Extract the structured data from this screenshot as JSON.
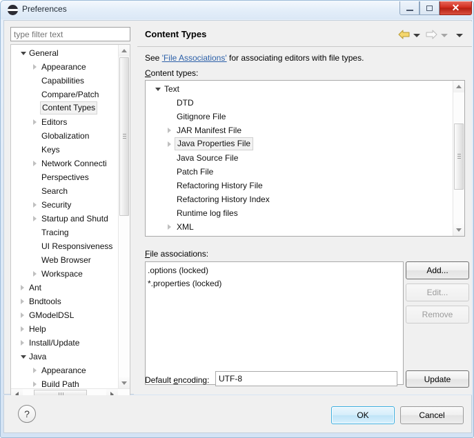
{
  "window": {
    "title": "Preferences",
    "icon": "preferences-icon",
    "controls": {
      "minimize": "minimize-icon",
      "maximize": "maximize-icon",
      "close": "✕"
    }
  },
  "sidebar": {
    "filter": {
      "value": "",
      "placeholder": "type filter text"
    },
    "items": [
      {
        "label": "General",
        "depth": 0,
        "arrow": "open",
        "selected": false
      },
      {
        "label": "Appearance",
        "depth": 1,
        "arrow": "collapsed",
        "selected": false
      },
      {
        "label": "Capabilities",
        "depth": 1,
        "arrow": "none",
        "selected": false
      },
      {
        "label": "Compare/Patch",
        "depth": 1,
        "arrow": "none",
        "selected": false
      },
      {
        "label": "Content Types",
        "depth": 1,
        "arrow": "none",
        "selected": true
      },
      {
        "label": "Editors",
        "depth": 1,
        "arrow": "collapsed",
        "selected": false
      },
      {
        "label": "Globalization",
        "depth": 1,
        "arrow": "none",
        "selected": false
      },
      {
        "label": "Keys",
        "depth": 1,
        "arrow": "none",
        "selected": false
      },
      {
        "label": "Network Connecti",
        "depth": 1,
        "arrow": "collapsed",
        "selected": false
      },
      {
        "label": "Perspectives",
        "depth": 1,
        "arrow": "none",
        "selected": false
      },
      {
        "label": "Search",
        "depth": 1,
        "arrow": "none",
        "selected": false
      },
      {
        "label": "Security",
        "depth": 1,
        "arrow": "collapsed",
        "selected": false
      },
      {
        "label": "Startup and Shutd",
        "depth": 1,
        "arrow": "collapsed",
        "selected": false
      },
      {
        "label": "Tracing",
        "depth": 1,
        "arrow": "none",
        "selected": false
      },
      {
        "label": "UI Responsiveness",
        "depth": 1,
        "arrow": "none",
        "selected": false
      },
      {
        "label": "Web Browser",
        "depth": 1,
        "arrow": "none",
        "selected": false
      },
      {
        "label": "Workspace",
        "depth": 1,
        "arrow": "collapsed",
        "selected": false
      },
      {
        "label": "Ant",
        "depth": 0,
        "arrow": "collapsed",
        "selected": false
      },
      {
        "label": "Bndtools",
        "depth": 0,
        "arrow": "collapsed",
        "selected": false
      },
      {
        "label": "GModelDSL",
        "depth": 0,
        "arrow": "collapsed",
        "selected": false
      },
      {
        "label": "Help",
        "depth": 0,
        "arrow": "collapsed",
        "selected": false
      },
      {
        "label": "Install/Update",
        "depth": 0,
        "arrow": "collapsed",
        "selected": false
      },
      {
        "label": "Java",
        "depth": 0,
        "arrow": "open",
        "selected": false
      },
      {
        "label": "Appearance",
        "depth": 1,
        "arrow": "collapsed",
        "selected": false
      },
      {
        "label": "Build Path",
        "depth": 1,
        "arrow": "collapsed",
        "selected": false
      }
    ]
  },
  "page": {
    "title": "Content Types",
    "nav": {
      "back_icon": "back-arrow-icon",
      "forward_icon": "forward-arrow-icon",
      "menu_icon": "chevron-down-icon"
    },
    "description": {
      "prefix": "See ",
      "link": "'File Associations'",
      "suffix": " for associating editors with file types."
    },
    "content_types_label": {
      "mnemonic": "C",
      "rest": "ontent types:"
    },
    "content_types": [
      {
        "label": "Text",
        "depth": 0,
        "arrow": "open",
        "selected": false
      },
      {
        "label": "DTD",
        "depth": 1,
        "arrow": "none",
        "selected": false
      },
      {
        "label": "Gitignore File",
        "depth": 1,
        "arrow": "none",
        "selected": false
      },
      {
        "label": "JAR Manifest File",
        "depth": 1,
        "arrow": "collapsed",
        "selected": false
      },
      {
        "label": "Java Properties File",
        "depth": 1,
        "arrow": "collapsed",
        "selected": true
      },
      {
        "label": "Java Source File",
        "depth": 1,
        "arrow": "none",
        "selected": false
      },
      {
        "label": "Patch File",
        "depth": 1,
        "arrow": "none",
        "selected": false
      },
      {
        "label": "Refactoring History File",
        "depth": 1,
        "arrow": "none",
        "selected": false
      },
      {
        "label": "Refactoring History Index",
        "depth": 1,
        "arrow": "none",
        "selected": false
      },
      {
        "label": "Runtime log files",
        "depth": 1,
        "arrow": "none",
        "selected": false
      },
      {
        "label": "XML",
        "depth": 1,
        "arrow": "collapsed",
        "selected": false
      }
    ],
    "file_associations_label": {
      "mnemonic": "F",
      "rest": "ile associations:"
    },
    "file_associations": [
      ".options (locked)",
      "*.properties (locked)"
    ],
    "side_buttons": [
      {
        "label": "Add...",
        "mnemonic": "A",
        "enabled": true
      },
      {
        "label": "Edit...",
        "mnemonic": "d",
        "enabled": false
      },
      {
        "label": "Remove",
        "mnemonic": "R",
        "enabled": false
      }
    ],
    "encoding": {
      "label_pre": "Default ",
      "label_mnemonic": "e",
      "label_post": "ncoding:",
      "value": "UTF-8",
      "update_label": "Update",
      "update_mnemonic": "U"
    }
  },
  "footer": {
    "help_icon": "?",
    "ok_label": "OK",
    "cancel_label": "Cancel"
  },
  "colors": {
    "accent": "#3aaee0",
    "link": "#2b5fa8",
    "close_red": "#cf2a1c",
    "back_arrow": "#f5d76e",
    "forward_arrow": "#d8d8d8"
  }
}
